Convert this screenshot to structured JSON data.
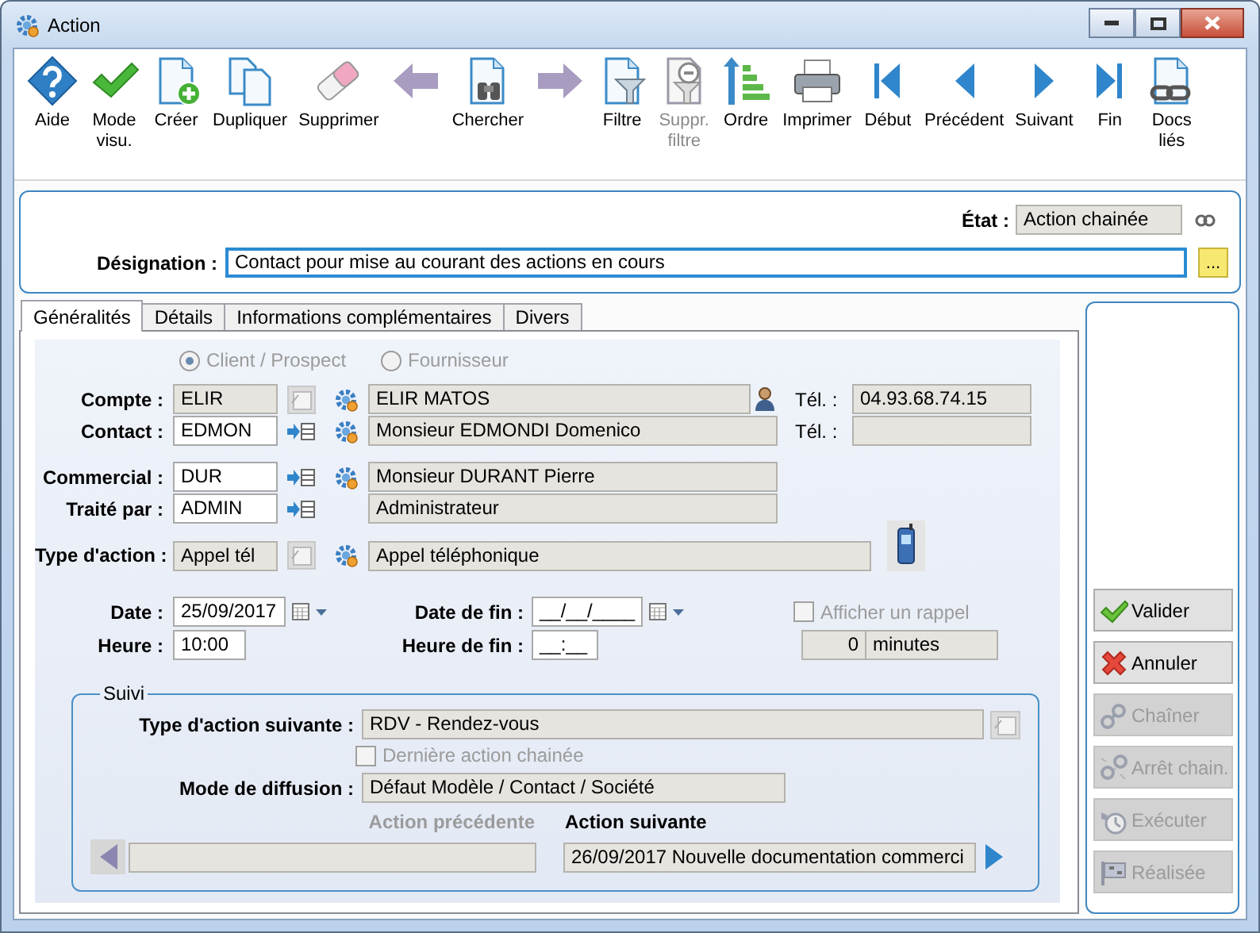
{
  "window": {
    "title": "Action"
  },
  "toolbar": [
    {
      "kind": "help",
      "label": "Aide",
      "disabled": false
    },
    {
      "kind": "check",
      "label": "Mode visu.",
      "disabled": false
    },
    {
      "kind": "new",
      "label": "Créer",
      "disabled": false
    },
    {
      "kind": "duplicate",
      "label": "Dupliquer",
      "disabled": false
    },
    {
      "kind": "delete",
      "label": "Supprimer",
      "disabled": false
    },
    {
      "kind": "arrow-left",
      "disabled": true
    },
    {
      "kind": "search",
      "label": "Chercher",
      "disabled": false
    },
    {
      "kind": "arrow-right",
      "disabled": true
    },
    {
      "kind": "filter",
      "label": "Filtre",
      "disabled": false
    },
    {
      "kind": "remove-filter",
      "label": "Suppr. filtre",
      "disabled": true
    },
    {
      "kind": "order",
      "label": "Ordre",
      "disabled": false
    },
    {
      "kind": "print",
      "label": "Imprimer",
      "disabled": false
    },
    {
      "kind": "first",
      "label": "Début",
      "disabled": false
    },
    {
      "kind": "previous",
      "label": "Précédent",
      "disabled": false
    },
    {
      "kind": "next",
      "label": "Suivant",
      "disabled": false
    },
    {
      "kind": "last",
      "label": "Fin",
      "disabled": false
    },
    {
      "kind": "links",
      "label": "Docs liés",
      "disabled": false
    }
  ],
  "header": {
    "state": {
      "label": "État :",
      "value": "Action chainée"
    },
    "designation": {
      "label": "Désignation :",
      "value": "Contact pour mise au courant des actions en cours"
    },
    "more_button": "..."
  },
  "tabs": [
    {
      "label": "Généralités",
      "selected": true
    },
    {
      "label": "Détails",
      "selected": false
    },
    {
      "label": "Informations complémentaires",
      "selected": false
    },
    {
      "label": "Divers",
      "selected": false
    }
  ],
  "general": {
    "party_type": {
      "disabled": true,
      "options": [
        {
          "label": "Client / Prospect",
          "selected": true
        },
        {
          "label": "Fournisseur",
          "selected": false
        }
      ]
    },
    "row_groups": [
      [
        {
          "label": "Compte :",
          "code": {
            "value": "ELIR",
            "readonly": true
          },
          "picker": {
            "kind": "lookup"
          },
          "gear": true,
          "name": "ELIR MATOS",
          "badge": {
            "kind": "person"
          },
          "phone": {
            "label": "Tél. :",
            "value": "04.93.68.74.15"
          }
        },
        {
          "label": "Contact :",
          "code": {
            "value": "EDMON",
            "readonly": false
          },
          "picker": {
            "kind": "list"
          },
          "gear": true,
          "name": "Monsieur EDMONDI Domenico",
          "phone": {
            "label": "Tél. :"
          }
        }
      ],
      [
        {
          "label": "Commercial :",
          "code": {
            "value": "DUR",
            "readonly": false
          },
          "picker": {
            "kind": "list"
          },
          "gear": true,
          "name": "Monsieur DURANT Pierre"
        },
        {
          "label": "Traité par :",
          "code": {
            "value": "ADMIN",
            "readonly": false
          },
          "picker": {
            "kind": "list"
          },
          "gear": false,
          "name": "Administrateur"
        }
      ],
      [
        {
          "label": "Type d'action :",
          "code": {
            "value": "Appel tél",
            "readonly": true
          },
          "picker": {
            "kind": "lookup"
          },
          "gear": true,
          "name": "Appel téléphonique",
          "badge": {
            "kind": "phone"
          }
        }
      ]
    ],
    "schedule": {
      "date": {
        "label": "Date :",
        "value": "25/09/2017"
      },
      "end_date": {
        "label": "Date de fin :",
        "value": "__/__/____"
      },
      "reminder": {
        "label": "Afficher un rappel",
        "checked": false,
        "disabled": true
      },
      "time": {
        "label": "Heure :",
        "value": "10:00"
      },
      "end_time": {
        "label": "Heure de fin :",
        "value": "__:__"
      },
      "reminder_delay": {
        "value": "0",
        "unit": "minutes"
      }
    }
  },
  "follow_up": {
    "title": "Suivi",
    "next_type": {
      "label": "Type d'action suivante :",
      "value": "RDV - Rendez-vous"
    },
    "last_chained": {
      "label": "Dernière action chainée",
      "checked": false,
      "disabled": true
    },
    "diffusion": {
      "label": "Mode de diffusion :",
      "value": "Défaut Modèle / Contact / Société"
    },
    "previous": {
      "label": "Action précédente",
      "disabled": true
    },
    "next": {
      "label": "Action suivante",
      "value": "26/09/2017 Nouvelle documentation commerci",
      "disabled": false
    }
  },
  "actions": [
    {
      "kind": "validate",
      "label": "Valider",
      "disabled": false
    },
    {
      "kind": "cancel",
      "label": "Annuler",
      "disabled": false
    },
    {
      "kind": "chain",
      "label": "Chaîner",
      "disabled": true
    },
    {
      "kind": "stop-chain",
      "label": "Arrêt chain.",
      "disabled": true
    },
    {
      "kind": "execute",
      "label": "Exécuter",
      "disabled": true
    },
    {
      "kind": "done",
      "label": "Réalisée",
      "disabled": true
    }
  ]
}
